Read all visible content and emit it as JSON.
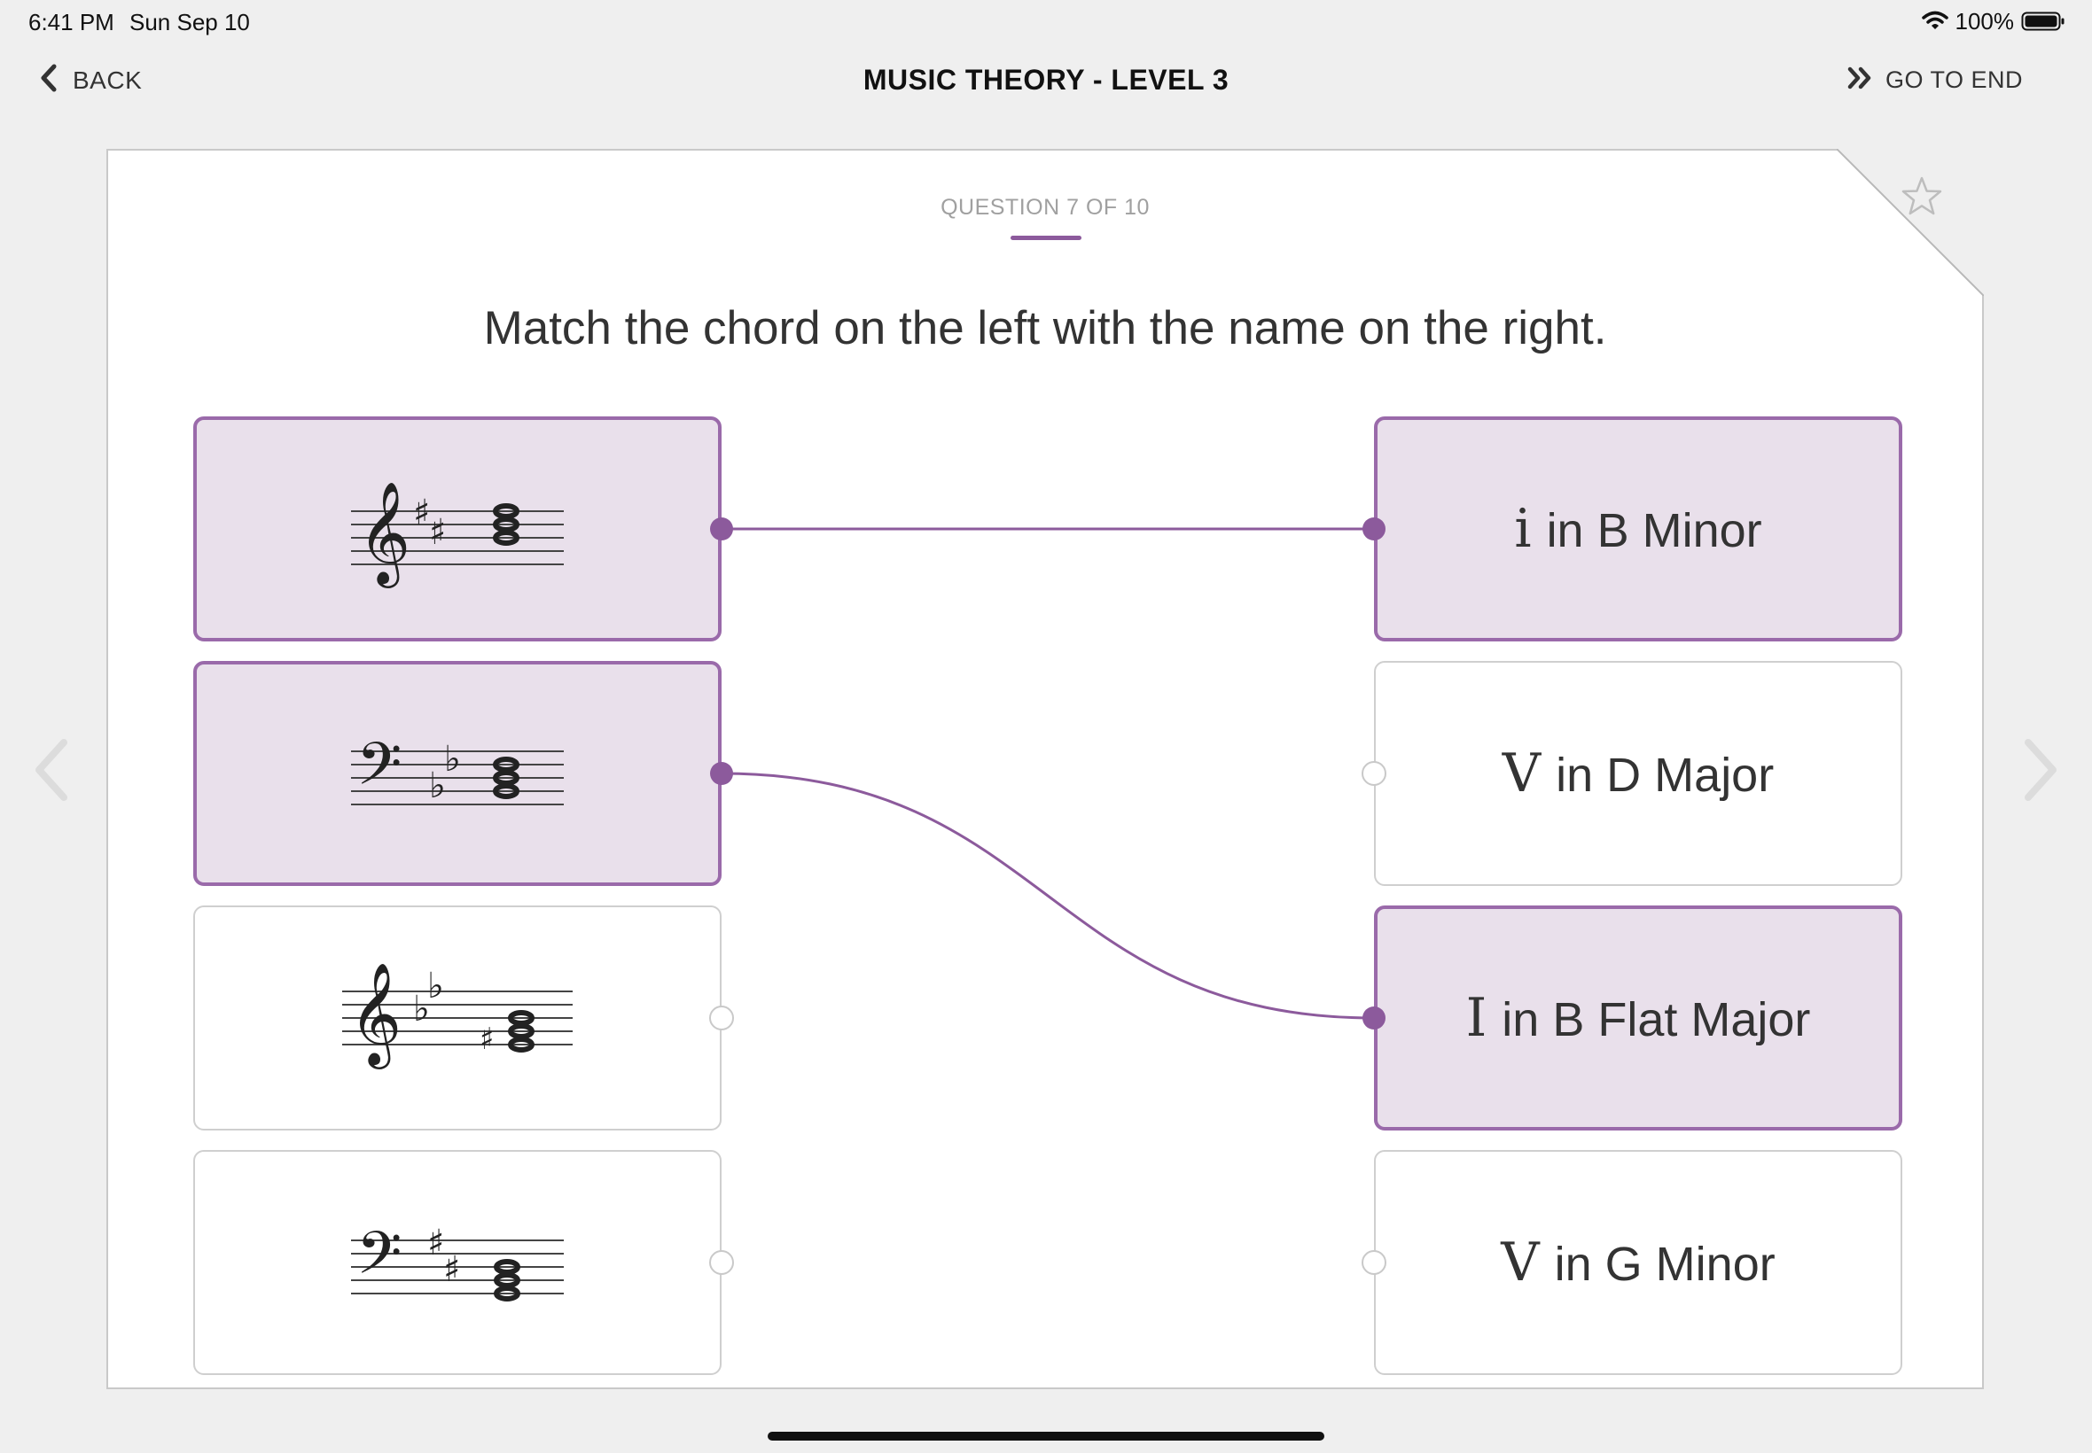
{
  "status_bar": {
    "time": "6:41 PM",
    "date": "Sun Sep 10",
    "battery": "100%",
    "icons": [
      "wifi-icon",
      "battery-icon"
    ]
  },
  "nav": {
    "back_label": "BACK",
    "title": "MUSIC THEORY - LEVEL 3",
    "goto_end_label": "GO TO END",
    "icons": [
      "chevron-left-icon",
      "double-chevron-right-icon"
    ]
  },
  "question": {
    "counter": "QUESTION 7 OF 10",
    "prompt": "Match the chord on the left with the name on the right.",
    "chords": [
      {
        "clef": "treble",
        "key_signature": "2 sharps",
        "selected": true
      },
      {
        "clef": "bass",
        "key_signature": "2 flats",
        "selected": true
      },
      {
        "clef": "treble",
        "key_signature": "2 flats",
        "accidental": "sharp",
        "selected": false
      },
      {
        "clef": "bass",
        "key_signature": "2 sharps",
        "selected": false
      }
    ],
    "names": [
      {
        "numeral": "i",
        "text": "in B Minor",
        "selected": true
      },
      {
        "numeral": "V",
        "text": "in D Major",
        "selected": false
      },
      {
        "numeral": "I",
        "text": "in B Flat Major",
        "selected": true
      },
      {
        "numeral": "V",
        "text": "in G Minor",
        "selected": false
      }
    ],
    "matches": [
      {
        "chord_index": 0,
        "name_index": 0
      },
      {
        "chord_index": 1,
        "name_index": 2
      }
    ]
  },
  "colors": {
    "accent": "#8c5a9c",
    "selected_fill": "#e9e0eb",
    "background": "#efefef"
  }
}
